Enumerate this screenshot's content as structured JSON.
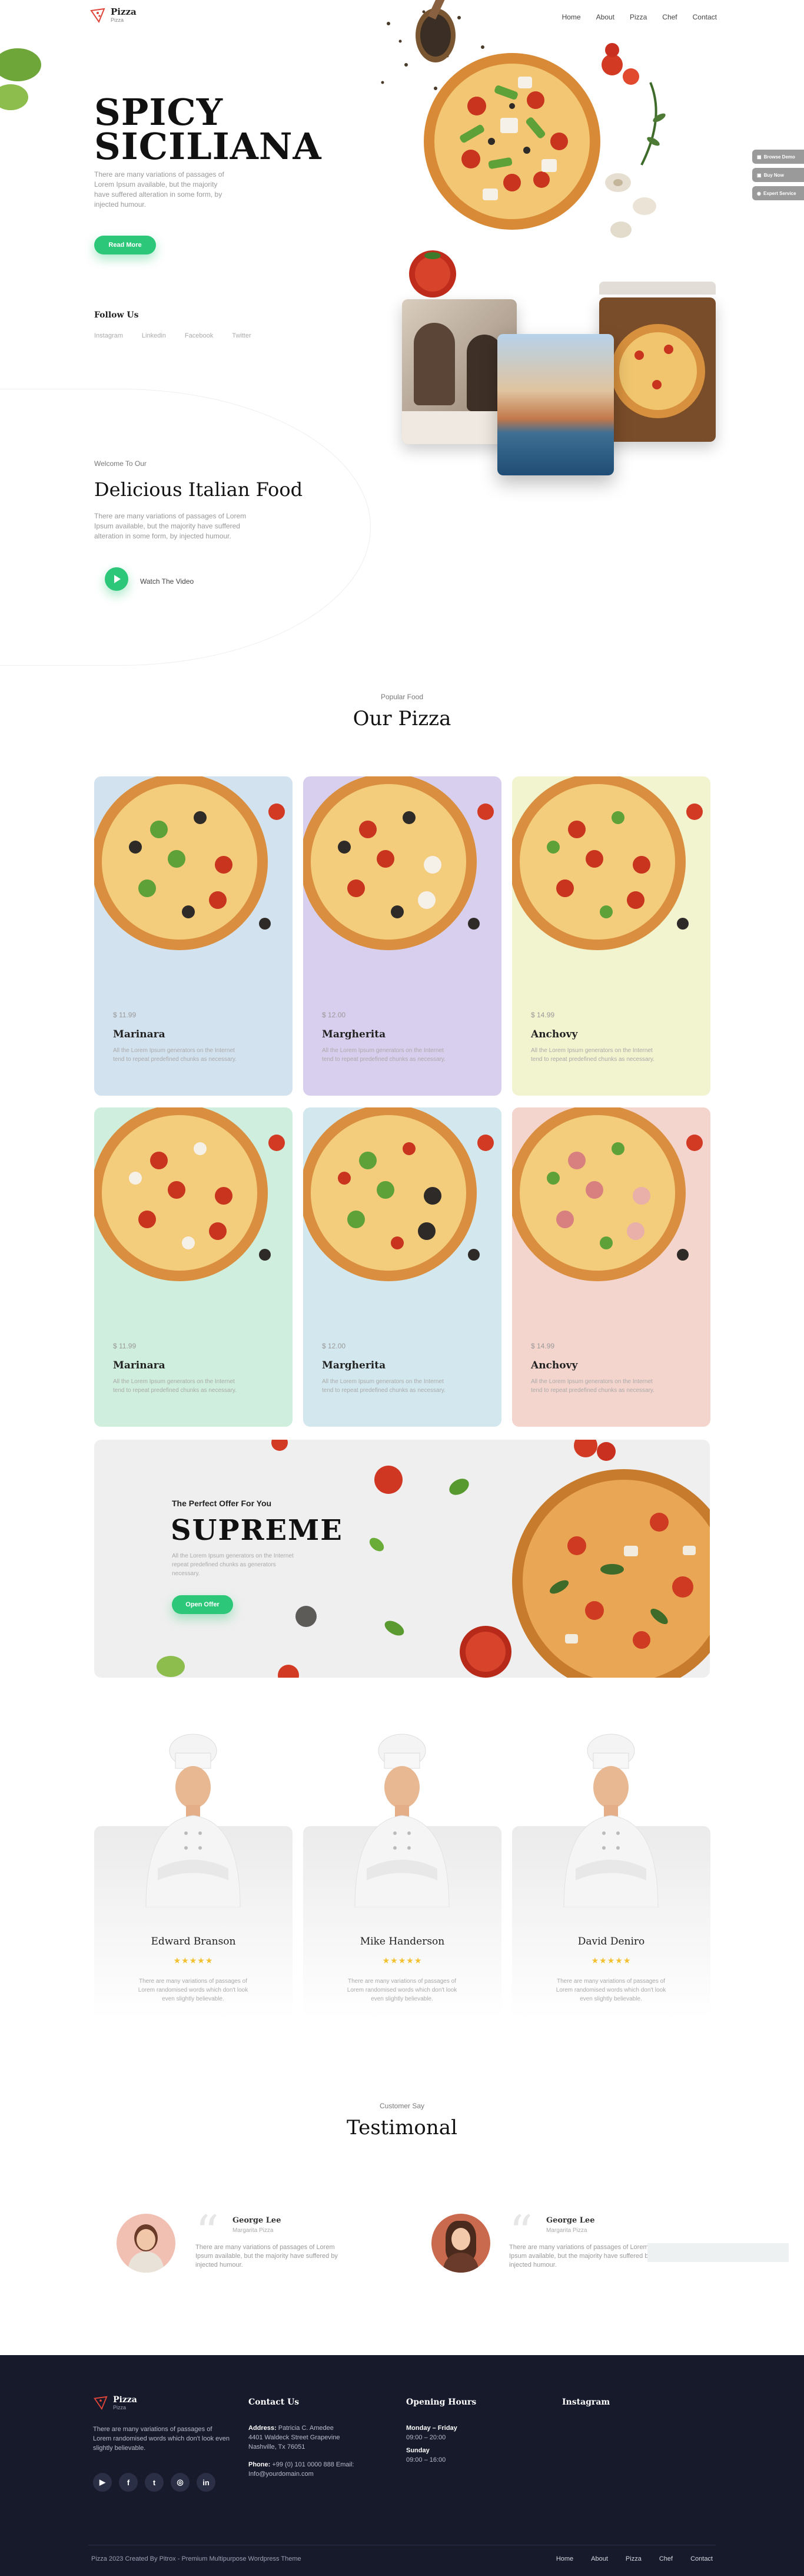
{
  "header": {
    "logo_name": "Pizza",
    "logo_sub": "Pizza",
    "nav": [
      "Home",
      "About",
      "Pizza",
      "Chef",
      "Contact"
    ]
  },
  "hero": {
    "title_line1": "SPICY",
    "title_line2": "SICILIANA",
    "description": "There are many variations of passages of Lorem Ipsum available, but the majority have suffered alteration in some form, by injected humour.",
    "button": "Read More",
    "follow_title": "Follow Us",
    "follow_links": [
      "Instagram",
      "Linkedin",
      "Facebook",
      "Twitter"
    ]
  },
  "side_tabs": [
    "Browse Demo",
    "Buy Now",
    "Expert Service"
  ],
  "welcome": {
    "kicker": "Welcome To Our",
    "title": "Delicious Italian Food",
    "description": "There are many variations of passages of Lorem Ipsum available, but the majority have suffered alteration in some form, by injected humour.",
    "watch": "Watch The Video"
  },
  "pizza_section": {
    "kicker": "Popular Food",
    "title": "Our Pizza",
    "cards": [
      {
        "price": "$ 11.99",
        "name": "Marinara",
        "desc": "All the Lorem Ipsum generators on the Internet tend to repeat predefined chunks as necessary.",
        "bg": "#d3e2ef"
      },
      {
        "price": "$ 12.00",
        "name": "Margherita",
        "desc": "All the Lorem Ipsum generators on the Internet tend to repeat predefined chunks as necessary.",
        "bg": "#d8cfee"
      },
      {
        "price": "$ 14.99",
        "name": "Anchovy",
        "desc": "All the Lorem Ipsum generators on the Internet tend to repeat predefined chunks as necessary.",
        "bg": "#f2f3cf"
      },
      {
        "price": "$ 11.99",
        "name": "Marinara",
        "desc": "All the Lorem Ipsum generators on the Internet tend to repeat predefined chunks as necessary.",
        "bg": "#cfeedd"
      },
      {
        "price": "$ 12.00",
        "name": "Margherita",
        "desc": "All the Lorem Ipsum generators on the Internet tend to repeat predefined chunks as necessary.",
        "bg": "#d3e8ee"
      },
      {
        "price": "$ 14.99",
        "name": "Anchovy",
        "desc": "All the Lorem Ipsum generators on the Internet tend to repeat predefined chunks as necessary.",
        "bg": "#f4d5cd"
      }
    ]
  },
  "offer": {
    "pre": "The Perfect Offer For You",
    "title": "SUPREME",
    "description": "All the Lorem Ipsum generators on the Internet repeat predefined chunks as generators necessary.",
    "button": "Open Offer"
  },
  "chefs": [
    {
      "name": "Edward Branson",
      "stars": "★★★★★",
      "desc": "There are many variations of passages of Lorem randomised words which don't look even slightly believable."
    },
    {
      "name": "Mike Handerson",
      "stars": "★★★★★",
      "desc": "There are many variations of passages of Lorem randomised words which don't look even slightly believable."
    },
    {
      "name": "David Deniro",
      "stars": "★★★★★",
      "desc": "There are many variations of passages of Lorem randomised words which don't look even slightly believable."
    }
  ],
  "testimonial": {
    "kicker": "Customer Say",
    "title": "Testimonal",
    "items": [
      {
        "name": "George Lee",
        "role": "Margarita Pizza",
        "text": "There are many variations of passages of Lorem Ipsum available, but the majority have suffered by injected humour."
      },
      {
        "name": "George Lee",
        "role": "Margarita Pizza",
        "text": "There are many variations of passages of Lorem Ipsum available, but the majority have suffered by injected humour."
      }
    ]
  },
  "footer": {
    "logo_name": "Pizza",
    "logo_sub": "Pizza",
    "about": "There are many variations of passages of Lorem randomised words which don't look even slightly believable.",
    "contact_title": "Contact Us",
    "address_label": "Address:",
    "address": "Patricia C. Amedee 4401 Waldeck Street Grapevine Nashville, Tx 76051",
    "phone_label": "Phone:",
    "phone": "+99 (0) 101 0000 888 Email: Info@yourdomain.com",
    "hours_title": "Opening Hours",
    "hours_day1": "Monday – Friday",
    "hours_time1": "09:00 – 20:00",
    "hours_day2": "Sunday",
    "hours_time2": "09:00 – 16:00",
    "instagram_title": "Instagram",
    "social": [
      "▶",
      "f",
      "t",
      "◎",
      "in"
    ],
    "copyright": "Pizza 2023 Created By Pitrox - Premium Multipurpose Wordpress Theme",
    "nav": [
      "Home",
      "About",
      "Pizza",
      "Chef",
      "Contact"
    ]
  },
  "colors": {
    "accent": "#2dc77a",
    "footer_bg": "#161a2b",
    "star": "#f3c12f"
  }
}
